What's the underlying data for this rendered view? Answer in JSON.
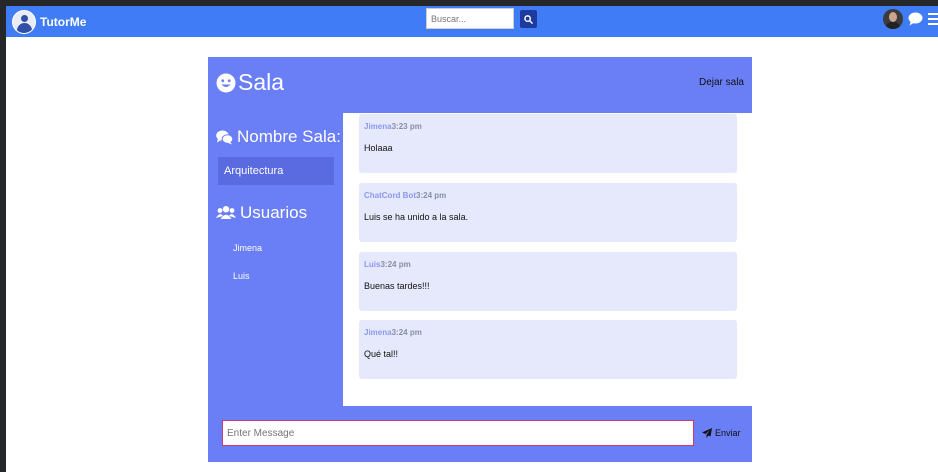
{
  "navbar": {
    "brand": "TutorMe",
    "search_placeholder": "Buscar...",
    "icons": [
      "user-avatar-icon",
      "search-icon",
      "chat-bubble-icon",
      "menu-icon"
    ]
  },
  "room": {
    "title": "Sala",
    "leave_label": "Dejar sala",
    "room_name_heading": "Nombre Sala:",
    "room_name": "Arquitectura",
    "users_heading": "Usuarios",
    "users": [
      "Jimena",
      "Luis"
    ]
  },
  "messages": [
    {
      "user": "Jimena",
      "time": "3:23 pm",
      "text": "Holaaa"
    },
    {
      "user": "ChatCord Bot",
      "time": "3:24 pm",
      "text": "Luis se ha unido a la sala."
    },
    {
      "user": "Luis",
      "time": "3:24 pm",
      "text": "Buenas tardes!!!"
    },
    {
      "user": "Jimena",
      "time": "3:24 pm",
      "text": "Qué tal!!"
    }
  ],
  "composer": {
    "placeholder": "Enter Message",
    "send_label": "Enviar"
  },
  "colors": {
    "navbar": "#3f7cf5",
    "panel": "#6a7ef5",
    "message_bg": "#e6e9fb",
    "username": "#8a99ee"
  }
}
